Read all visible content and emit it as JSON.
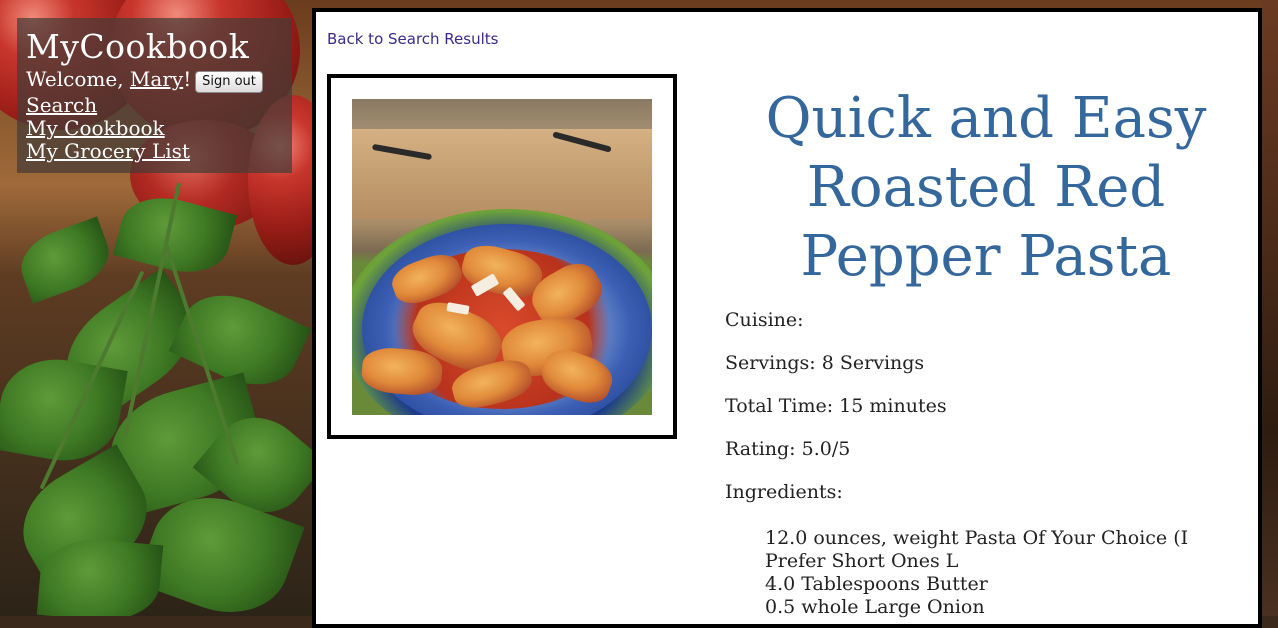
{
  "nav": {
    "brand": "MyCookbook",
    "welcome_prefix": "Welcome, ",
    "user_name": "Mary",
    "welcome_suffix": "!",
    "sign_out_label": "Sign out",
    "links": [
      "Search",
      "My Cookbook",
      "My Grocery List"
    ]
  },
  "recipe": {
    "back_link": "Back to Search Results",
    "title": "Quick and Easy Roasted Red Pepper Pasta",
    "cuisine_line": "Cuisine:",
    "servings_line": "Servings: 8 Servings",
    "total_time_line": "Total Time: 15 minutes",
    "rating_line": "Rating: 5.0/5",
    "ingredients_heading": "Ingredients:",
    "ingredients": [
      "12.0 ounces, weight Pasta Of Your Choice (I Prefer Short Ones L",
      "4.0 Tablespoons Butter",
      "0.5 whole Large Onion"
    ]
  },
  "colors": {
    "title": "#34679b",
    "link": "#3c2a86",
    "panel_border": "#000000"
  }
}
